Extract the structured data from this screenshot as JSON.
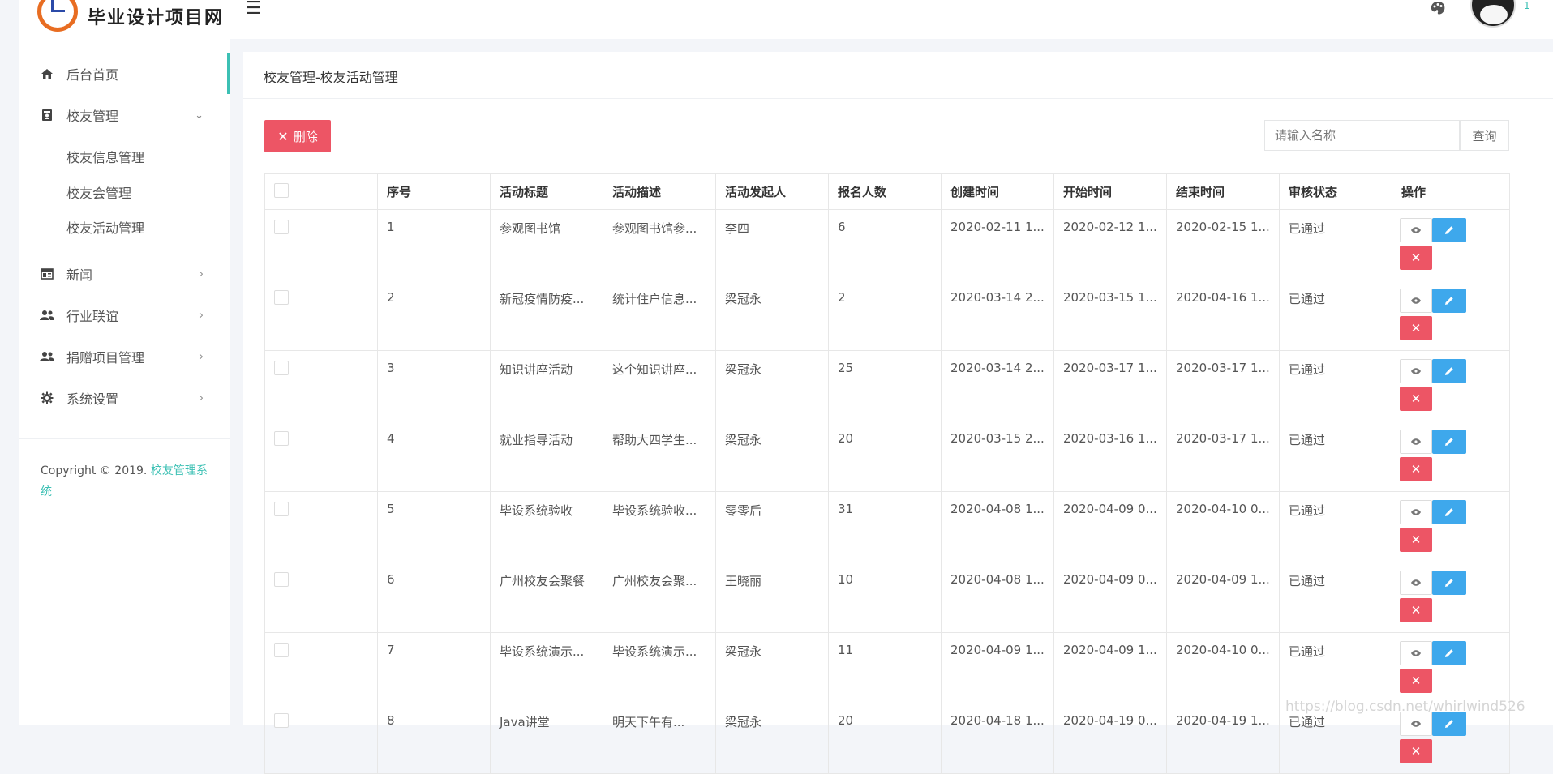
{
  "app": {
    "logo_text": "毕业设计项目网"
  },
  "sidebar": {
    "items": [
      {
        "label": "后台首页",
        "icon": "home-icon"
      },
      {
        "label": "校友管理",
        "icon": "contact-icon",
        "expanded": true,
        "children": [
          "校友信息管理",
          "校友会管理",
          "校友活动管理"
        ]
      },
      {
        "label": "新闻",
        "icon": "news-icon"
      },
      {
        "label": "行业联谊",
        "icon": "group-icon"
      },
      {
        "label": "捐赠项目管理",
        "icon": "group-icon"
      },
      {
        "label": "系统设置",
        "icon": "gear-icon"
      }
    ],
    "copyright_prefix": "Copyright © 2019. ",
    "copyright_link": "校友管理系统"
  },
  "topbar": {
    "user_initial": "1"
  },
  "breadcrumb": "校友管理-校友活动管理",
  "toolbar": {
    "delete_label": "删除",
    "search_placeholder": "请输入名称",
    "search_button": "查询"
  },
  "table": {
    "headers": [
      "",
      "序号",
      "活动标题",
      "活动描述",
      "活动发起人",
      "报名人数",
      "创建时间",
      "开始时间",
      "结束时间",
      "审核状态",
      "操作"
    ],
    "rows": [
      [
        "1",
        "参观图书馆",
        "参观图书馆参...",
        "李四",
        "6",
        "2020-02-11 1...",
        "2020-02-12 1...",
        "2020-02-15 1...",
        "已通过"
      ],
      [
        "2",
        "新冠疫情防疫...",
        "统计住户信息...",
        "梁冠永",
        "2",
        "2020-03-14 2...",
        "2020-03-15 1...",
        "2020-04-16 1...",
        "已通过"
      ],
      [
        "3",
        "知识讲座活动",
        "这个知识讲座...",
        "梁冠永",
        "25",
        "2020-03-14 2...",
        "2020-03-17 1...",
        "2020-03-17 1...",
        "已通过"
      ],
      [
        "4",
        "就业指导活动",
        "帮助大四学生...",
        "梁冠永",
        "20",
        "2020-03-15 2...",
        "2020-03-16 1...",
        "2020-03-17 1...",
        "已通过"
      ],
      [
        "5",
        "毕设系统验收",
        "毕设系统验收...",
        "零零后",
        "31",
        "2020-04-08 1...",
        "2020-04-09 0...",
        "2020-04-10 0...",
        "已通过"
      ],
      [
        "6",
        "广州校友会聚餐",
        "广州校友会聚...",
        "王晓丽",
        "10",
        "2020-04-08 1...",
        "2020-04-09 0...",
        "2020-04-09 1...",
        "已通过"
      ],
      [
        "7",
        "毕设系统演示...",
        "毕设系统演示...",
        "梁冠永",
        "11",
        "2020-04-09 1...",
        "2020-04-09 1...",
        "2020-04-10 0...",
        "已通过"
      ],
      [
        "8",
        "Java讲堂",
        "明天下午有...",
        "梁冠永",
        "20",
        "2020-04-18 1...",
        "2020-04-19 0...",
        "2020-04-19 1...",
        "已通过"
      ]
    ]
  },
  "watermark": "https://blog.csdn.net/whirlwind526"
}
